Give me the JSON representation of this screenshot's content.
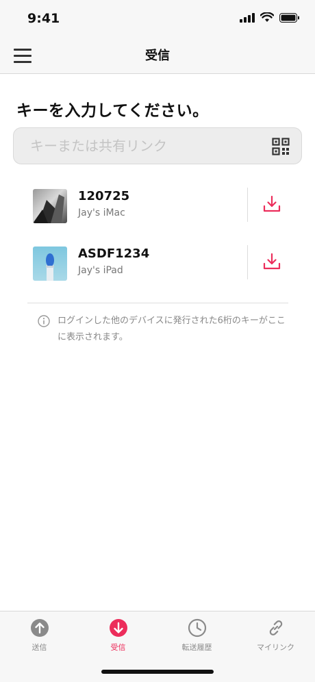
{
  "status_bar": {
    "time": "9:41"
  },
  "nav": {
    "title": "受信"
  },
  "prompt": "キーを入力してください。",
  "search": {
    "value": "",
    "placeholder": "キーまたは共有リンク"
  },
  "devices": [
    {
      "key": "120725",
      "name": "Jay's iMac"
    },
    {
      "key": "ASDF1234",
      "name": "Jay's iPad"
    }
  ],
  "info": {
    "text": "ログインした他のデバイスに発行された6桁のキーがここに表示されます。"
  },
  "tabs": [
    {
      "label": "送信",
      "icon": "arrow-up-circle-icon",
      "active": false
    },
    {
      "label": "受信",
      "icon": "arrow-down-circle-icon",
      "active": true
    },
    {
      "label": "転送履歴",
      "icon": "clock-icon",
      "active": false
    },
    {
      "label": "マイリンク",
      "icon": "link-icon",
      "active": false
    }
  ],
  "colors": {
    "accent": "#ec2d5b",
    "inactive": "#8a8a8a"
  }
}
